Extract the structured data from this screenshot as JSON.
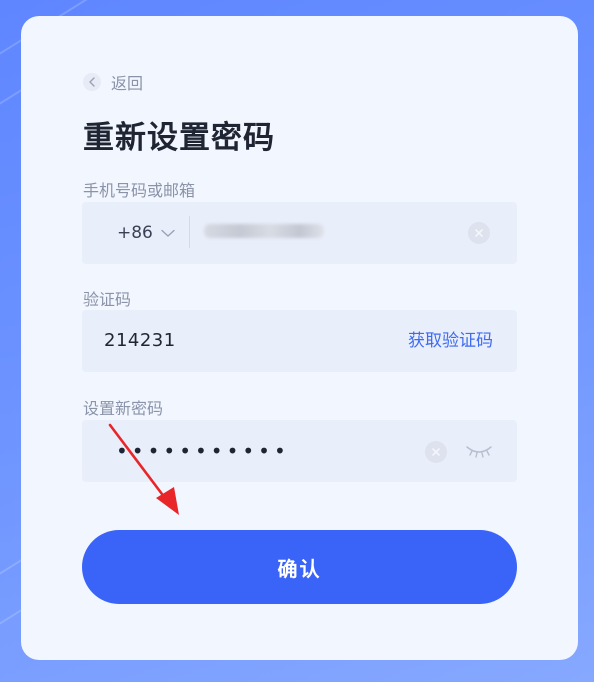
{
  "back": {
    "label": "返回",
    "icon": "chevron-left-icon"
  },
  "title": "重新设置密码",
  "phone": {
    "label": "手机号码或邮箱",
    "country_code": "+86",
    "dropdown_icon": "chevron-down-icon",
    "clear_icon": "clear-icon"
  },
  "code": {
    "label": "验证码",
    "value": "214231",
    "get_code_label": "获取验证码"
  },
  "password": {
    "label": "设置新密码",
    "masked_value": "•••••••••••",
    "clear_icon": "clear-icon",
    "toggle_icon": "eye-closed-icon"
  },
  "confirm": {
    "label": "确认"
  },
  "colors": {
    "primary": "#3a63f7",
    "link": "#3e6bf0",
    "annotation_arrow": "#e8262a"
  }
}
